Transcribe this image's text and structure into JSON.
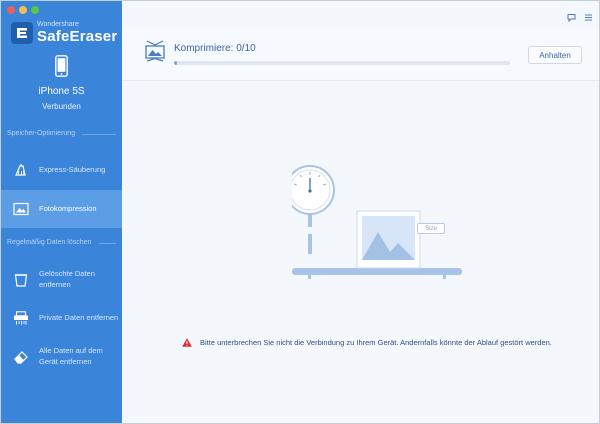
{
  "brand": {
    "small": "Wondershare",
    "name": "SafeEraser"
  },
  "device": {
    "name": "iPhone 5S",
    "status": "Verbunden"
  },
  "sidebar": {
    "section_storage": "Speicher-Optimierung",
    "section_erase": "Regelmäßig Daten löschen",
    "items": [
      {
        "label": "Express-Säuberung",
        "icon": "broom-icon",
        "active": false
      },
      {
        "label": "Fotokompression",
        "icon": "photo-icon",
        "active": true
      },
      {
        "label": "Gelöschte Daten entfernen",
        "icon": "trash-icon",
        "active": false
      },
      {
        "label": "Private Daten entfernen",
        "icon": "shredder-icon",
        "active": false
      },
      {
        "label": "Alle Daten auf dem Gerät entfernen",
        "icon": "eraser-icon",
        "active": false
      }
    ]
  },
  "progress": {
    "title": "Komprimiere: 0/10",
    "fraction": 0.01,
    "button_label": "Anhalten"
  },
  "illustration": {
    "size_label": "Size"
  },
  "warning": {
    "text": "Bitte unterbrechen Sie nicht die Verbindung zu Ihrem Gerät. Andernfalls könnte der Ablauf gestört werden."
  },
  "colors": {
    "sidebar": "#3a84da",
    "sidebar_active": "#5c9ee6",
    "accent_text": "#3a67a8",
    "warning": "#e0282e"
  }
}
